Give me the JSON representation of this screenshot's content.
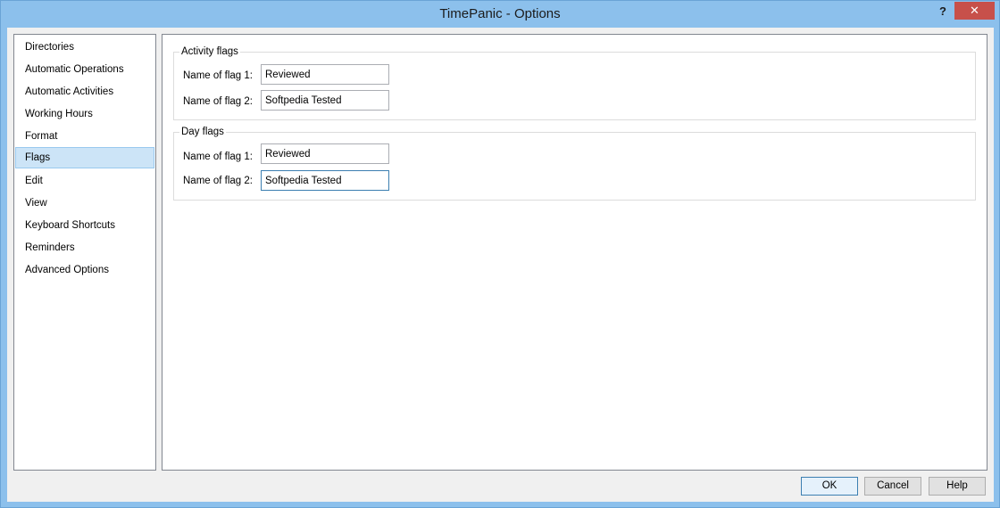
{
  "window": {
    "title": "TimePanic - Options",
    "help_glyph": "?",
    "close_glyph": "✕"
  },
  "sidebar": {
    "items": [
      {
        "label": "Directories"
      },
      {
        "label": "Automatic Operations"
      },
      {
        "label": "Automatic Activities"
      },
      {
        "label": "Working Hours"
      },
      {
        "label": "Format"
      },
      {
        "label": "Flags",
        "selected": true
      },
      {
        "label": "Edit"
      },
      {
        "label": "View"
      },
      {
        "label": "Keyboard Shortcuts"
      },
      {
        "label": "Reminders"
      },
      {
        "label": "Advanced Options"
      }
    ]
  },
  "activity_flags": {
    "title": "Activity flags",
    "flag1_label": "Name of flag 1:",
    "flag1_value": "Reviewed",
    "flag2_label": "Name of flag 2:",
    "flag2_value": "Softpedia Tested"
  },
  "day_flags": {
    "title": "Day flags",
    "flag1_label": "Name of flag 1:",
    "flag1_value": "Reviewed",
    "flag2_label": "Name of flag 2:",
    "flag2_value": "Softpedia Tested"
  },
  "buttons": {
    "ok": "OK",
    "cancel": "Cancel",
    "help": "Help"
  },
  "colors": {
    "titlebar": "#8cc0ec",
    "close_button": "#c7504a",
    "selection": "#cce4f7",
    "focus_border": "#3c7fb1"
  }
}
